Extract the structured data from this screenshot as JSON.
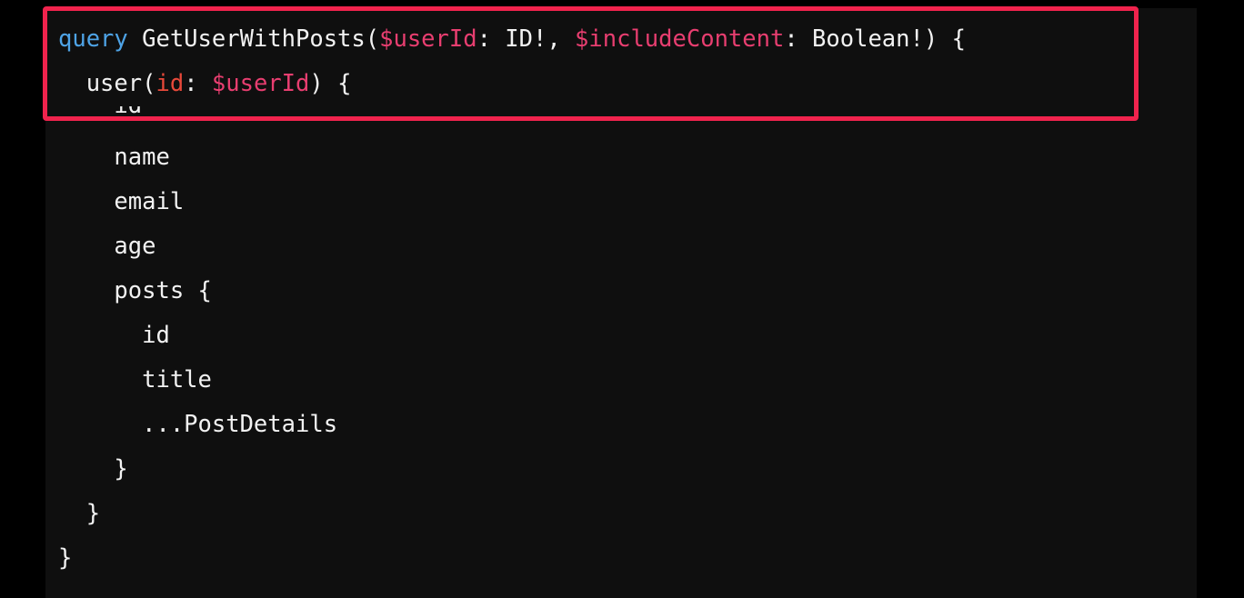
{
  "editor": {
    "highlight_color": "#f0234d",
    "background_color": "#0f0f0f",
    "keyword_color": "#4ea3e6",
    "variable_color": "#e83e70",
    "argument_color": "#e8493a",
    "lines": [
      {
        "tokens": [
          {
            "text": "query",
            "kind": "keyword"
          },
          {
            "text": " GetUserWithPosts(",
            "kind": "plain"
          },
          {
            "text": "$userId",
            "kind": "variable"
          },
          {
            "text": ": ID!, ",
            "kind": "plain"
          },
          {
            "text": "$includeContent",
            "kind": "variable"
          },
          {
            "text": ": Boolean!) {",
            "kind": "plain"
          }
        ]
      },
      {
        "tokens": [
          {
            "text": "  user(",
            "kind": "plain"
          },
          {
            "text": "id",
            "kind": "argname"
          },
          {
            "text": ": ",
            "kind": "plain"
          },
          {
            "text": "$userId",
            "kind": "variable"
          },
          {
            "text": ") {",
            "kind": "plain"
          }
        ]
      },
      {
        "tokens": [
          {
            "text": "    id",
            "kind": "plain"
          }
        ]
      },
      {
        "tokens": [
          {
            "text": "    name",
            "kind": "plain"
          }
        ]
      },
      {
        "tokens": [
          {
            "text": "    email",
            "kind": "plain"
          }
        ]
      },
      {
        "tokens": [
          {
            "text": "    age",
            "kind": "plain"
          }
        ]
      },
      {
        "tokens": [
          {
            "text": "    posts {",
            "kind": "plain"
          }
        ]
      },
      {
        "tokens": [
          {
            "text": "      id",
            "kind": "plain"
          }
        ]
      },
      {
        "tokens": [
          {
            "text": "      title",
            "kind": "plain"
          }
        ]
      },
      {
        "tokens": [
          {
            "text": "      ...PostDetails",
            "kind": "plain"
          }
        ]
      },
      {
        "tokens": [
          {
            "text": "    }",
            "kind": "plain"
          }
        ]
      },
      {
        "tokens": [
          {
            "text": "  }",
            "kind": "plain"
          }
        ]
      },
      {
        "tokens": [
          {
            "text": "}",
            "kind": "plain"
          }
        ]
      }
    ]
  }
}
